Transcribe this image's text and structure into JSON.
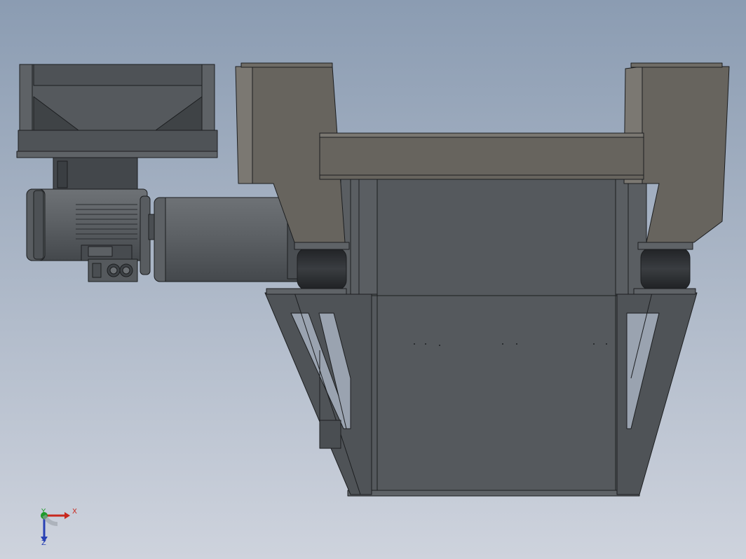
{
  "viewport": {
    "background_top": "#8b9cb2",
    "background_bottom": "#ced3dd"
  },
  "colors": {
    "steel_dark": "#4d5155",
    "steel_mid": "#585c60",
    "steel_light": "#6a6e72",
    "khaki": "#67645e",
    "rubber": "#2b2d30",
    "edge": "#1c1e20",
    "motor": "#5b5f63"
  },
  "triad": {
    "x_label": "X",
    "y_label": "Y",
    "z_label": "Z",
    "x_color": "#c8281e",
    "y_color": "#1e9a2a",
    "z_color": "#2840b4"
  }
}
